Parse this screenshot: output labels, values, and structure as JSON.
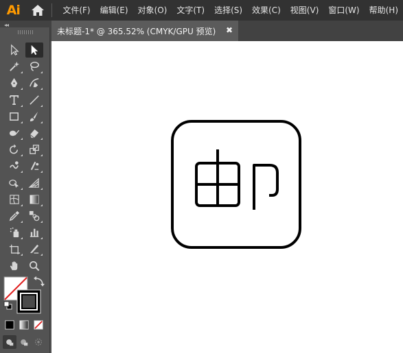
{
  "app": {
    "logo": "Ai",
    "menu": [
      "文件(F)",
      "编辑(E)",
      "对象(O)",
      "文字(T)",
      "选择(S)",
      "效果(C)",
      "视图(V)",
      "窗口(W)",
      "帮助(H)"
    ]
  },
  "document": {
    "tab_title": "未标题-1* @ 365.52% (CMYK/GPU 预览)",
    "close_glyph": "✖"
  },
  "panel": {
    "collapse_glyph": "◂◂"
  },
  "colors": {
    "menubar_bg": "#323232",
    "toolbar_bg": "#535353",
    "tab_bg": "#5b5b5b",
    "logo": "#ff9a00",
    "canvas": "#ffffff",
    "stroke": "#000000",
    "none_slash": "#e02020"
  },
  "tools": [
    "selection-tool",
    "direct-selection-tool",
    "magic-wand-tool",
    "lasso-tool",
    "pen-tool",
    "curvature-tool",
    "type-tool",
    "line-segment-tool",
    "rectangle-tool",
    "paintbrush-tool",
    "shaper-tool",
    "eraser-tool",
    "rotate-tool",
    "scale-tool",
    "warp-tool",
    "free-transform-tool",
    "shape-builder-tool",
    "perspective-grid-tool",
    "mesh-tool",
    "gradient-tool",
    "eyedropper-tool",
    "blend-tool",
    "symbol-sprayer-tool",
    "column-graph-tool",
    "artboard-tool",
    "slice-tool",
    "hand-tool",
    "zoom-tool"
  ]
}
